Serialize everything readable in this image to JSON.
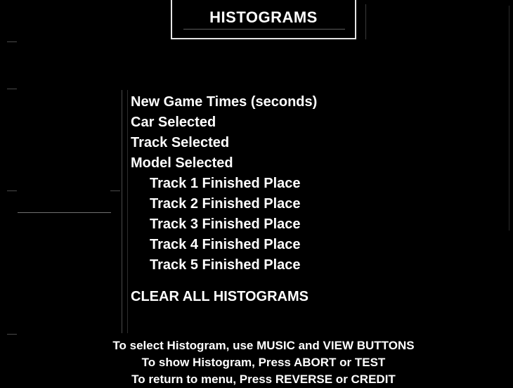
{
  "title": "HISTOGRAMS",
  "menu": {
    "items": [
      "New Game Times (seconds)",
      "Car Selected",
      "Track Selected",
      "Model Selected",
      "Track 1 Finished Place",
      "Track 2 Finished Place",
      "Track 3 Finished Place",
      "Track 4 Finished Place",
      "Track 5 Finished Place",
      "CLEAR ALL HISTOGRAMS"
    ]
  },
  "instructions": [
    "To select Histogram, use MUSIC and VIEW BUTTONS",
    "To show Histogram, Press ABORT or TEST",
    "To return to menu, Press REVERSE or CREDIT"
  ],
  "colors": {
    "background": "#000000",
    "text": "#ffffff",
    "frame": "#e6e6e6"
  }
}
